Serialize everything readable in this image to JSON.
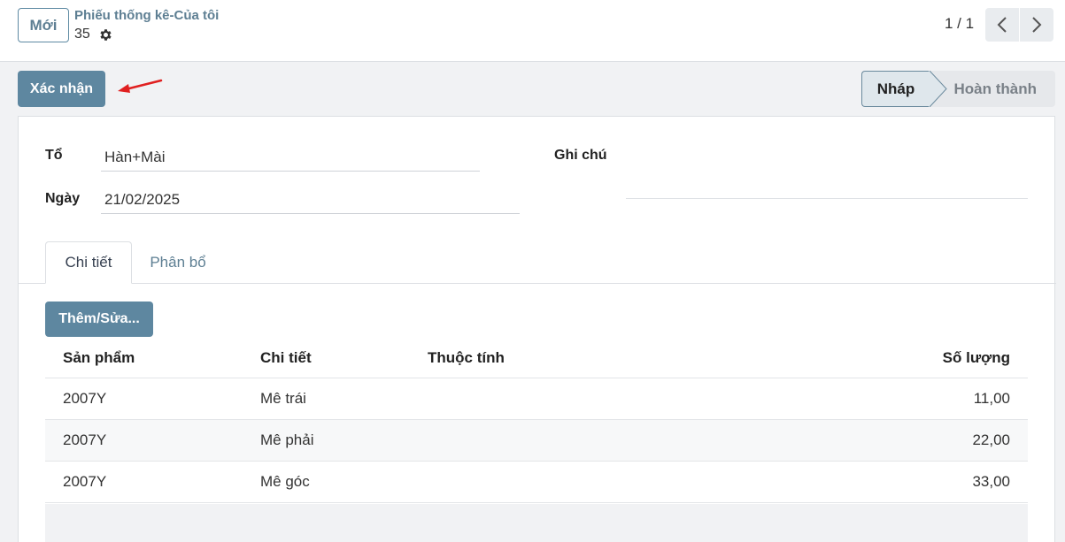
{
  "control_panel": {
    "new_button": "Mới",
    "breadcrumb_link": "Phiếu thống kê-Của tôi",
    "record_id": "35",
    "pager_value": "1 / 1"
  },
  "actions": {
    "confirm_button": "Xác nhận"
  },
  "statusbar": {
    "draft": "Nháp",
    "done": "Hoàn thành"
  },
  "form": {
    "to_label": "Tổ",
    "to_value": "Hàn+Mài",
    "date_label": "Ngày",
    "date_value": "21/02/2025",
    "note_label": "Ghi chú",
    "note_value": ""
  },
  "tabs": {
    "detail": "Chi tiết",
    "allocation": "Phân bổ"
  },
  "table": {
    "add_button": "Thêm/Sửa...",
    "headers": [
      "Sản phẩm",
      "Chi tiết",
      "Thuộc tính",
      "Số lượng"
    ],
    "rows": [
      [
        "2007Y",
        "Mê trái",
        "",
        "11,00"
      ],
      [
        "2007Y",
        "Mê phải",
        "",
        "22,00"
      ],
      [
        "2007Y",
        "Mê góc",
        "",
        "33,00"
      ]
    ]
  },
  "icons": [
    "gear-icon",
    "chevron-left-icon",
    "chevron-right-icon",
    "annotation-arrow"
  ],
  "colors": {
    "primary": "#5e87a0",
    "link": "#5e7f93",
    "annotation": "#e02020"
  }
}
